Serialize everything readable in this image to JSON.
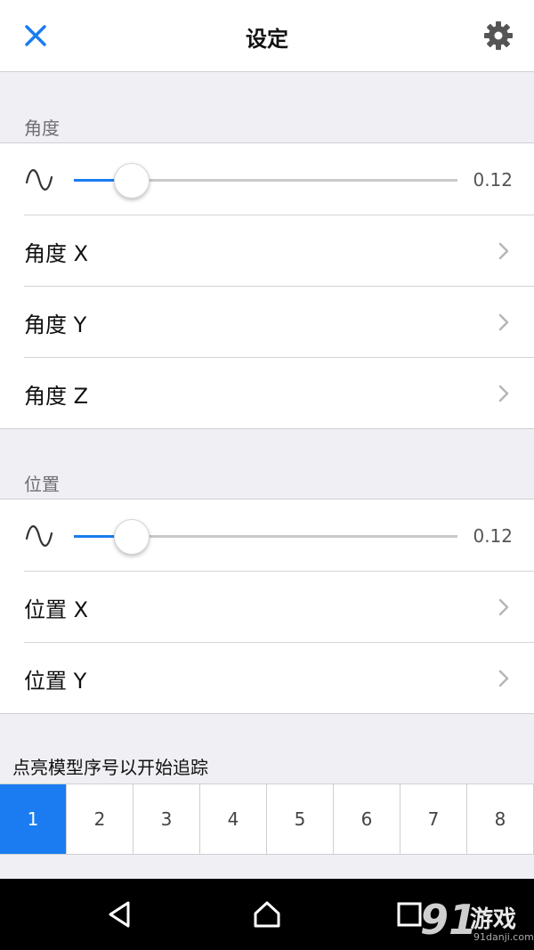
{
  "header": {
    "title": "设定",
    "close_icon": "close-icon",
    "settings_icon": "gear-icon"
  },
  "colors": {
    "accent": "#1a7cf0",
    "background": "#efeff4"
  },
  "angle": {
    "section_title": "角度",
    "slider_value": "0.12",
    "slider_fraction": 0.15,
    "items": [
      {
        "label": "角度 X"
      },
      {
        "label": "角度 Y"
      },
      {
        "label": "角度 Z"
      }
    ]
  },
  "position": {
    "section_title": "位置",
    "slider_value": "0.12",
    "slider_fraction": 0.15,
    "items": [
      {
        "label": "位置 X"
      },
      {
        "label": "位置 Y"
      }
    ]
  },
  "tracking": {
    "title": "点亮模型序号以开始追踪",
    "models": [
      "1",
      "2",
      "3",
      "4",
      "5",
      "6",
      "7",
      "8"
    ],
    "selected": "1"
  },
  "nav": {
    "back_icon": "back-triangle-icon",
    "home_icon": "home-icon",
    "recents_icon": "recents-square-icon"
  },
  "watermark": {
    "number": "91",
    "text": "游戏",
    "url": "91danji.com"
  }
}
